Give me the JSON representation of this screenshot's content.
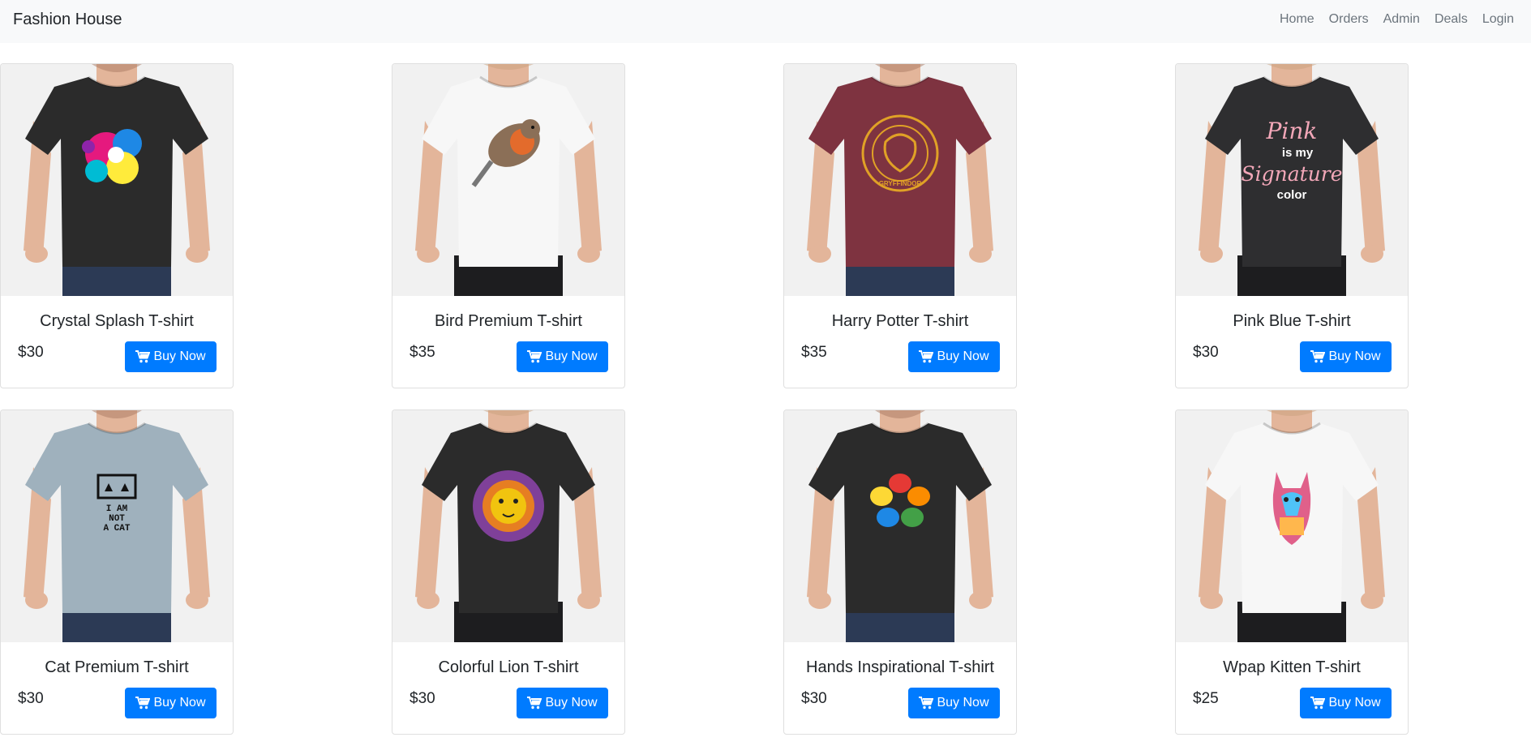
{
  "navbar": {
    "brand": "Fashion House",
    "links": [
      "Home",
      "Orders",
      "Admin",
      "Deals",
      "Login"
    ]
  },
  "button_label": "Buy Now",
  "products": [
    {
      "title": "Crystal Splash T-shirt",
      "price": "$30",
      "shirt_color": "#2b2b2b",
      "model": "man",
      "print": "splash"
    },
    {
      "title": "Bird Premium T-shirt",
      "price": "$35",
      "shirt_color": "#f7f7f7",
      "model": "woman",
      "print": "bird"
    },
    {
      "title": "Harry Potter T-shirt",
      "price": "$35",
      "shirt_color": "#7e3340",
      "model": "man",
      "print": "crest"
    },
    {
      "title": "Pink Blue T-shirt",
      "price": "$30",
      "shirt_color": "#2e2e30",
      "model": "woman",
      "print": "text"
    },
    {
      "title": "Cat Premium T-shirt",
      "price": "$30",
      "shirt_color": "#9fb1bd",
      "model": "man",
      "print": "cat-text"
    },
    {
      "title": "Colorful Lion T-shirt",
      "price": "$30",
      "shirt_color": "#2b2b2b",
      "model": "woman",
      "print": "lion"
    },
    {
      "title": "Hands Inspirational T-shirt",
      "price": "$30",
      "shirt_color": "#2b2b2b",
      "model": "man",
      "print": "hands"
    },
    {
      "title": "Wpap Kitten T-shirt",
      "price": "$25",
      "shirt_color": "#f7f7f7",
      "model": "woman",
      "print": "kitten"
    }
  ],
  "print_text": {
    "pink": "Pink",
    "is_my": "is my",
    "signature": "Signature",
    "color": "color",
    "cat_line1": "I AM",
    "cat_line2": "NOT",
    "cat_line3": "A CAT",
    "crest": "GRYFFINDOR"
  },
  "colors": {
    "primary": "#007bff",
    "navbar_bg": "#f8f9fa",
    "nav_link": "#6c757d",
    "skin": "#e3b59a",
    "jeans": "#2c3a55"
  },
  "icons": {
    "cart": "shopping-cart-icon"
  }
}
